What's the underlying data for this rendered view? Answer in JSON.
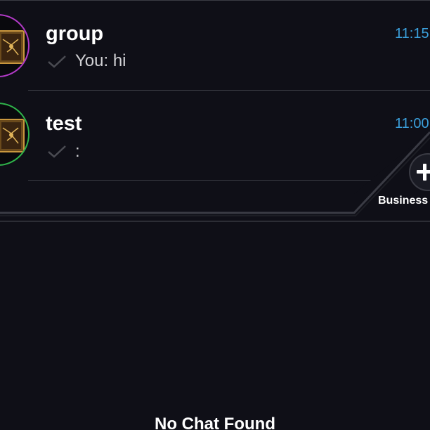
{
  "chats": [
    {
      "name": "group",
      "time": "11:15",
      "preview": "You: hi",
      "ring_color": "#b13ac6",
      "avatar_icon": "card-thumbnail-icon",
      "status_icon": "check-icon"
    },
    {
      "name": "test",
      "time": "11:00",
      "preview": ":",
      "ring_color": "#2fb34a",
      "avatar_icon": "card-thumbnail-icon",
      "status_icon": "check-icon"
    }
  ],
  "fab": {
    "label": "Business",
    "icon": "plus-icon"
  },
  "empty_state": {
    "text": "No Chat Found"
  },
  "colors": {
    "background": "#0f0f17",
    "divider": "#3a3b44",
    "time": "#3ba0dc",
    "text": "#ffffff",
    "preview": "#d0d0d4"
  }
}
